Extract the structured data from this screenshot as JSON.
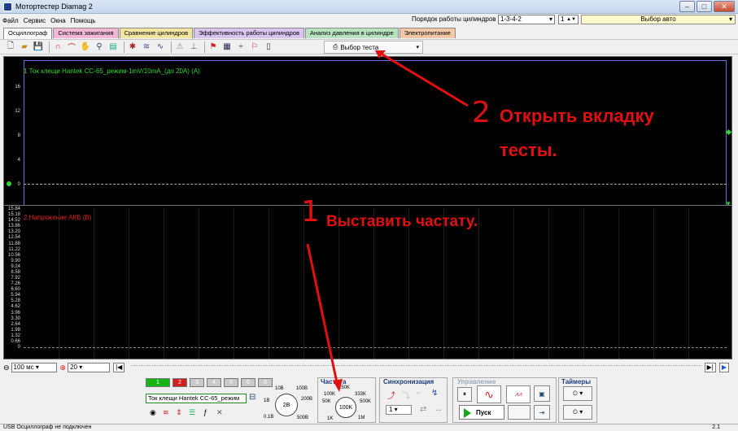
{
  "window": {
    "title": "Мотортестер Diamag 2"
  },
  "menu": [
    "Файл",
    "Сервис",
    "Окна",
    "Помощь"
  ],
  "cylinders": {
    "label": "Порядок работы цилиндров",
    "order": "1-3-4-2",
    "spin": "1",
    "auto": "Выбор авто"
  },
  "tabs": [
    {
      "label": "Осциллограф",
      "color": "#ffffff"
    },
    {
      "label": "Система зажигания",
      "color": "#f2b8d6"
    },
    {
      "label": "Сравнение цилиндров",
      "color": "#f3e6a0"
    },
    {
      "label": "Эффективность работы цилиндров",
      "color": "#d9c3ef"
    },
    {
      "label": "Анализ давления в цилиндре",
      "color": "#b8e3c0"
    },
    {
      "label": "Электропитание",
      "color": "#f3c7a8"
    }
  ],
  "toolbar": {
    "tests_label": "Выбор теста"
  },
  "scope": {
    "ch1": {
      "label": "1 Ток клещи Hantek CC-65_режим-1mV/10mA_(до 20A) (A)",
      "color": "#2ed62e",
      "ticks": [
        "16",
        "12",
        "8",
        "4",
        "0"
      ]
    },
    "ch2": {
      "label": "2 Напряжение АКБ (В)",
      "color": "#e21f1f",
      "ticks": [
        "15.84",
        "15.18",
        "14.52",
        "13.86",
        "13.20",
        "12.54",
        "11.88",
        "11.22",
        "10.56",
        "9.90",
        "9.24",
        "8.58",
        "7.92",
        "7.26",
        "6.60",
        "5.94",
        "5.28",
        "4.62",
        "3.96",
        "3.30",
        "2.64",
        "1.98",
        "1.32",
        "0.66",
        "0"
      ]
    }
  },
  "timebar": {
    "time": "100 мс",
    "scale": "20"
  },
  "controls": {
    "channels": [
      "1",
      "2",
      "3",
      "4",
      "5",
      "6",
      "0"
    ],
    "probe": "Ток клещи Hantek CC-65_режим",
    "volt_knob": "2В",
    "volt_marks": [
      "10В",
      "100В",
      "1В",
      "200В",
      "0.1В",
      "500В"
    ],
    "freq_title": "Частота",
    "freq_knob": "100K",
    "freq_marks": [
      "250K",
      "100K",
      "333K",
      "50K",
      "500K",
      "1K",
      "1M"
    ],
    "sync_title": "Синхронизация",
    "sync_value": "1",
    "control_title": "Управление",
    "start_label": "Пуск",
    "timers_title": "Таймеры"
  },
  "status": {
    "left": "USB Осциллограф не подключен",
    "right": "2.1"
  },
  "annotations": {
    "a1_num": "1",
    "a1_text": "Выставить частату.",
    "a2_num": "2",
    "a2_text_1": "Открыть вкладку",
    "a2_text_2": "тесты."
  }
}
